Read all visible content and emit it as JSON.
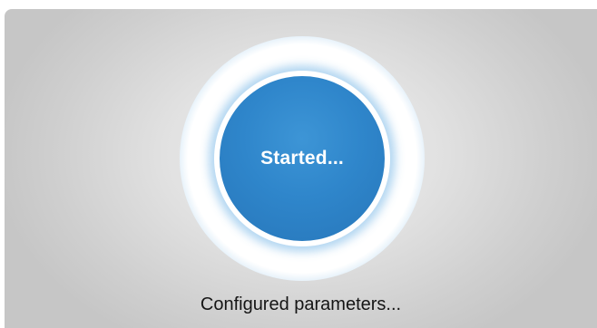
{
  "progress_indicator": {
    "center_label": "Started...",
    "accent_color": "#2f86cb",
    "glow_color": "#c6e0f4"
  },
  "status": {
    "message": "Configured parameters..."
  }
}
